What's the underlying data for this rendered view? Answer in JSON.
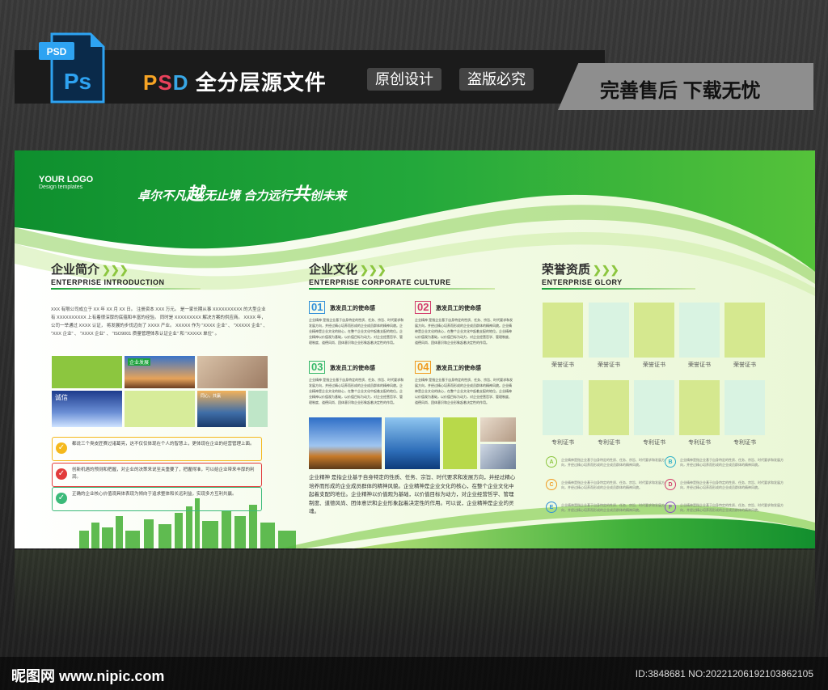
{
  "header": {
    "file_badge": "PSD",
    "ps_label": "Ps",
    "psd_p": "P",
    "psd_s": "S",
    "psd_d": "D",
    "title_rest": "全分层源文件",
    "pill_1": "原创设计",
    "pill_2": "盗版必究",
    "after_sales": "完善售后 下载无忧"
  },
  "board": {
    "logo_title": "YOUR LOGO",
    "logo_sub": "Design templates",
    "slogan_a": "卓尔不凡",
    "slogan_b": "越",
    "slogan_c": "无止境 合力远行",
    "slogan_d": "共",
    "slogan_e": "创未来"
  },
  "intro": {
    "title": "企业简介",
    "arrows": "❯❯❯",
    "subtitle": "ENTERPRISE INTRODUCTION",
    "paragraph": "XXX 有限公司成立于 XX 年 XX 月 XX 日。 注册资本 XXX 万元。 是一家长期从事 XXXXXXXXXX 的大型企业有 XXXXXXXXXX 上有着很深厚的底蕴和丰富的经验。 同时是 XXXXXXXXX 解决方案的供应商。 XXXX 年， 公司一举通过 XXXX 认证， 将发展的步伐迈向了 XXXX 产业。 XXXXX 作为 \"XXXX 企业\" 、 \"XXXXX 企业\" 、 \"XXX 企业\" 、 \"XXXX 企业\" 、 \"ISO9001 质量管理体系认证企业\" 和 \"XXXXX 单位\" 。",
    "checks": [
      {
        "text": "都说三个臭皮匠赛过诸葛亮，这不仅仅体现在个人的智慧上，更体现在企业的经营管理上面。",
        "color": "#f5b81c",
        "icon": "✓"
      },
      {
        "text": "创新机遇的预测和把握，对企业的决策来说至关重要了，把握得准，可以给企业带来丰厚的利润。",
        "color": "#e23b3b",
        "icon": "✓"
      },
      {
        "text": "正确的企业核心价值观具体表现为倾向于追求整体和长远利益，实现多方互利共赢。",
        "color": "#3cba7a",
        "icon": "✓"
      }
    ]
  },
  "culture": {
    "title": "企业文化",
    "arrows": "❯❯❯",
    "subtitle": "ENTERPRISE CORPORATE CULTURE",
    "items": [
      {
        "num": "01",
        "title": "激发员工的使命感",
        "color": "#2f8fd8"
      },
      {
        "num": "02",
        "title": "激发员工的使命感",
        "color": "#d23a6a"
      },
      {
        "num": "03",
        "title": "激发员工的使命感",
        "color": "#35b86a"
      },
      {
        "num": "04",
        "title": "激发员工的使命感",
        "color": "#f09a1f"
      }
    ],
    "item_text": "企业精神 是指企业基于自身特定的性质、任务、宗旨、时代要求和发展方向，并经过精心培养而形成的企业成员群体的精神风貌。企业精神是企业文化的核心，在整个企业文化中起着支配的地位。企业精神以价值观为基础，以价值目标为动力，对企业经营哲学、管理制度、道德风尚、团体意识和企业形象起着决定性的作用。",
    "paragraph": "企业精神 是指企业基于自身特定的性质、任务、宗旨、时代要求和发展方向，并经过精心培养而形成的企业成员群体的精神风貌。企业精神是企业文化的核心，在整个企业文化中起着支配的地位。企业精神以价值观为基础，以价值目标为动力，对企业经营哲学、管理制度、道德风尚、团体意识和企业形象起着决定性的作用。可以说，企业精神是企业的灵魂。"
  },
  "glory": {
    "title": "荣誉资质",
    "arrows": "❯❯❯",
    "subtitle": "ENTERPRISE GLORY",
    "honor_label": "荣誉证书",
    "patent_label": "专利证书",
    "letters_left": [
      "A",
      "C",
      "E"
    ],
    "letters_right": [
      "B",
      "D",
      "F"
    ],
    "letter_colors": [
      "#8cc63f",
      "#f09a1f",
      "#2f8fd8",
      "#2fb0c8",
      "#d23a6a",
      "#8a4fc2"
    ],
    "letter_text": "企业精神是指企业基于自身特定的性质、任务、宗旨、时代要求和发展方向，并经过精心培养而形成的企业成员群体的精神风貌。"
  },
  "pictures": {
    "intro_pic_text_1": "企业发展",
    "intro_pic_text_2": "诚信",
    "intro_pic_text_3": "同心，共赢"
  },
  "watermark": {
    "site": "昵图网 www.nipic.com",
    "id": "ID:3848681 NO:20221206192103862105"
  },
  "colors": {
    "brand_green": "#1aa23a",
    "light_green": "#8cc63f",
    "pale_green": "#d7f0e0",
    "lime_box": "#b8d94a"
  }
}
